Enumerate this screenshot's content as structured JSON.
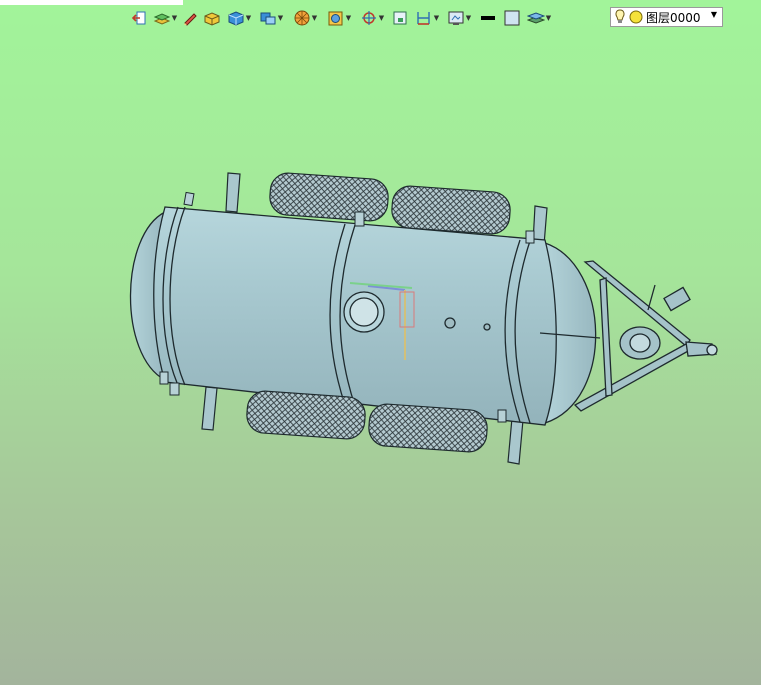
{
  "toolbar": {
    "items": [
      {
        "icon": "exit-arrow-icon"
      },
      {
        "icon": "layer-stack-icon",
        "has_dropdown": true
      },
      {
        "icon": "pen-edit-icon"
      },
      {
        "icon": "yellow-box-icon"
      },
      {
        "icon": "blue-cube-icon",
        "has_dropdown": true
      },
      {
        "icon": "view-orientation-icon",
        "has_dropdown": true
      },
      {
        "icon": "section-pie-icon",
        "has_dropdown": true
      },
      {
        "icon": "render-mode-icon",
        "has_dropdown": true
      },
      {
        "icon": "snap-target-icon",
        "has_dropdown": true
      },
      {
        "icon": "frame-icon"
      },
      {
        "icon": "dimension-icon",
        "has_dropdown": true
      },
      {
        "icon": "display-settings-icon",
        "has_dropdown": true
      },
      {
        "icon": "line-color-icon"
      },
      {
        "icon": "fill-color-icon"
      },
      {
        "icon": "layer-properties-icon",
        "has_dropdown": true
      }
    ]
  },
  "layer_selector": {
    "value": "图层0000",
    "visibility_icon": "bulb-icon",
    "state_icon": "yellow-circle-icon"
  },
  "viewport": {
    "background_top": "#a2f49a",
    "background_bottom": "#a3b49c",
    "model_color": "#a9cbd0"
  }
}
